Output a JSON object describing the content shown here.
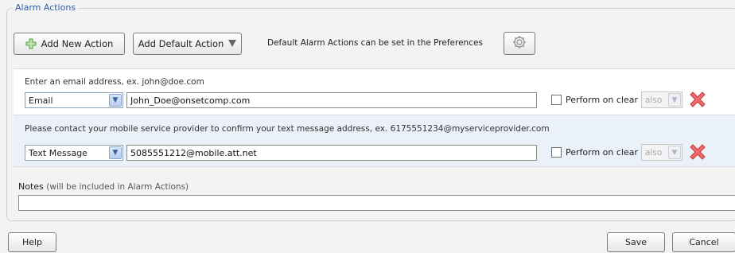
{
  "alarm_actions": {
    "legend": "Alarm Actions",
    "add_new_action_label": "Add New Action",
    "add_default_action_label": "Add Default Action",
    "preferences_hint": "Default Alarm Actions can be set in the Preferences",
    "actions": [
      {
        "hint": "Enter an email address, ex. john@doe.com",
        "type": "Email",
        "address": "John_Doe@onsetcomp.com",
        "perform_label": "Perform on clear",
        "perform_checked": false,
        "when": "also"
      },
      {
        "hint": "Please contact your mobile service provider to confirm your text message address, ex. 6175551234@myserviceprovider.com",
        "type": "Text Message",
        "address": "5085551212@mobile.att.net",
        "perform_label": "Perform on clear",
        "perform_checked": false,
        "when": "also"
      }
    ]
  },
  "notes": {
    "label": "Notes",
    "sublabel": "(will be included in Alarm Actions)",
    "value": ""
  },
  "footer": {
    "help_label": "Help",
    "save_label": "Save",
    "cancel_label": "Cancel"
  },
  "colors": {
    "legend": "#2a5db0",
    "delete_icon": "#e64b4b",
    "add_icon": "#4da33a",
    "text_row_bg": "#eaf1f9"
  },
  "icons": [
    "plus-icon",
    "caret-down-icon",
    "gear-icon",
    "chevron-down-icon",
    "delete-x-icon"
  ]
}
